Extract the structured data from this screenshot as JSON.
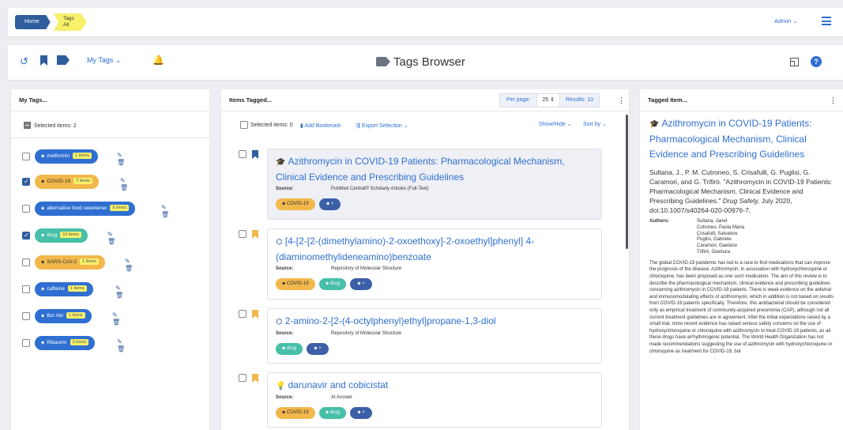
{
  "breadcrumb": {
    "home": "Home",
    "tags_line1": "Tags",
    "tags_line2": "All"
  },
  "header": {
    "user_menu": "Admin ⌄"
  },
  "toolbar": {
    "my_tags": "My Tags ⌄",
    "title": "Tags Browser"
  },
  "left_panel": {
    "title": "My Tags...",
    "selected": "Selected items: 2",
    "tags": [
      {
        "name": "metformin",
        "count": "1 items",
        "checked": false,
        "color": "#2f6fd1"
      },
      {
        "name": "COVID-19",
        "count": "7 items",
        "checked": true,
        "color": "#f2b84b"
      },
      {
        "name": "alternative food sweetener",
        "count": "6 items",
        "checked": false,
        "color": "#2f6fd1"
      },
      {
        "name": "drug",
        "count": "10 items",
        "checked": true,
        "color": "#48bfa8"
      },
      {
        "name": "SARS-CoV-2",
        "count": "1 items",
        "checked": false,
        "color": "#f2b84b"
      },
      {
        "name": "caffeine",
        "count": "1 items",
        "checked": false,
        "color": "#2f6fd1"
      },
      {
        "name": "Bcr Abl",
        "count": "1 items",
        "checked": false,
        "color": "#2f6fd1"
      },
      {
        "name": "Ribavirin",
        "count": "3 items",
        "checked": false,
        "color": "#2f6fd1"
      }
    ]
  },
  "center_panel": {
    "title": "Items Tagged...",
    "per_page_label": "Per page:",
    "per_page_value": "25 ⇕",
    "results": "Results: 10",
    "selected": "Selected items: 0",
    "add_bookmark": "Add Bookmark",
    "export": "Export Selection ⌄",
    "show_hide": "Show/Hide ⌄",
    "sort_by": "Sort by ⌄",
    "source_label": "Source:",
    "items": [
      {
        "title": "Azithromycin in COVID-19 Patients: Pharmacological Mechanism, Clinical Evidence and Prescribing Guidelines",
        "source": "PubMed Central® Scholarly Articles (Full-Text)",
        "chips": [
          "COVID-19",
          "+"
        ],
        "icon": "graduation-cap-icon",
        "glyph": "🎓",
        "bookmark": "blue"
      },
      {
        "title": "[4-[2-[2-(dimethylamino)-2-oxoethoxy]-2-oxoethyl]phenyl] 4-(diaminomethylideneamino)benzoate",
        "source": "Repository of Molecular Structure",
        "chips": [
          "COVID-19",
          "drug",
          "+"
        ],
        "icon": "molecule-icon",
        "glyph": "⌬",
        "bookmark": "orange"
      },
      {
        "title": "2-amino-2-[2-(4-octylphenyl)ethyl]propane-1,3-diol",
        "source": "Repository of Molecular Structure",
        "chips": [
          "drug",
          "+"
        ],
        "icon": "molecule-icon",
        "glyph": "⌬",
        "bookmark": "orange"
      },
      {
        "title": "darunavir and cobicistat",
        "source": "AI Answer",
        "chips": [
          "COVID-19",
          "drug",
          "+"
        ],
        "icon": "lightbulb-icon",
        "glyph": "💡",
        "bookmark": "orange"
      }
    ]
  },
  "right_panel": {
    "title": "Tagged Item...",
    "item_title": "Azithromycin in COVID-19 Patients: Pharmacological Mechanism, Clinical Evidence and Prescribing Guidelines",
    "citation_main": "Sultana, J., P. M. Cutroneo, S. Crisafulli, G. Puglisi, G. Caramori, and G. Trifirò. \"Azithromycin in COVID-19 Patients: Pharmacological Mechanism, Clinical Evidence and Prescribing Guidelines.\"",
    "citation_journal": "Drug Safety,",
    "citation_tail": "July 2020, doi:10.1007/s40264-020-00976-7;",
    "authors_label": "Authors:",
    "authors": [
      "Sultana, Janet",
      "Cutroneo, Paola Maria",
      "Crisafulli, Salvatore",
      "Puglisi, Gabriele",
      "Caramori, Gaetano",
      "Trifirò, Gianluca"
    ],
    "abstract": "The global COVID-19 pandemic has led to a race to find medications that can improve the prognosis of the disease. Azithromycin, in association with hydroxychloroquine or chloroquine, has been proposed as one such medication. The aim of this review is to describe the pharmacological mechanism, clinical evidence and prescribing guidelines concerning azithromycin in COVID-19 patients. There is weak evidence on the antiviral and immunomodulating effects of azithromycin, which in addition is not based on results from COVID-19 patients specifically. Therefore, this antibacterial should be considered only as empirical treatment of community-acquired pneumonia (CAP), although not all current treatment guidelines are in agreement. After the initial expectations raised by a small trial, more recent evidence has raised serious safety concerns on the use of hydroxychloroquine or chloroquine with azithromycin to treat COVID-19 patients, as all these drugs have arrhythmogenic potential. The World Health Organization has not made recommendations suggesting the use of azithromycin with hydroxychloroquine or chloroquine as treatment for COVID-19, but"
  }
}
